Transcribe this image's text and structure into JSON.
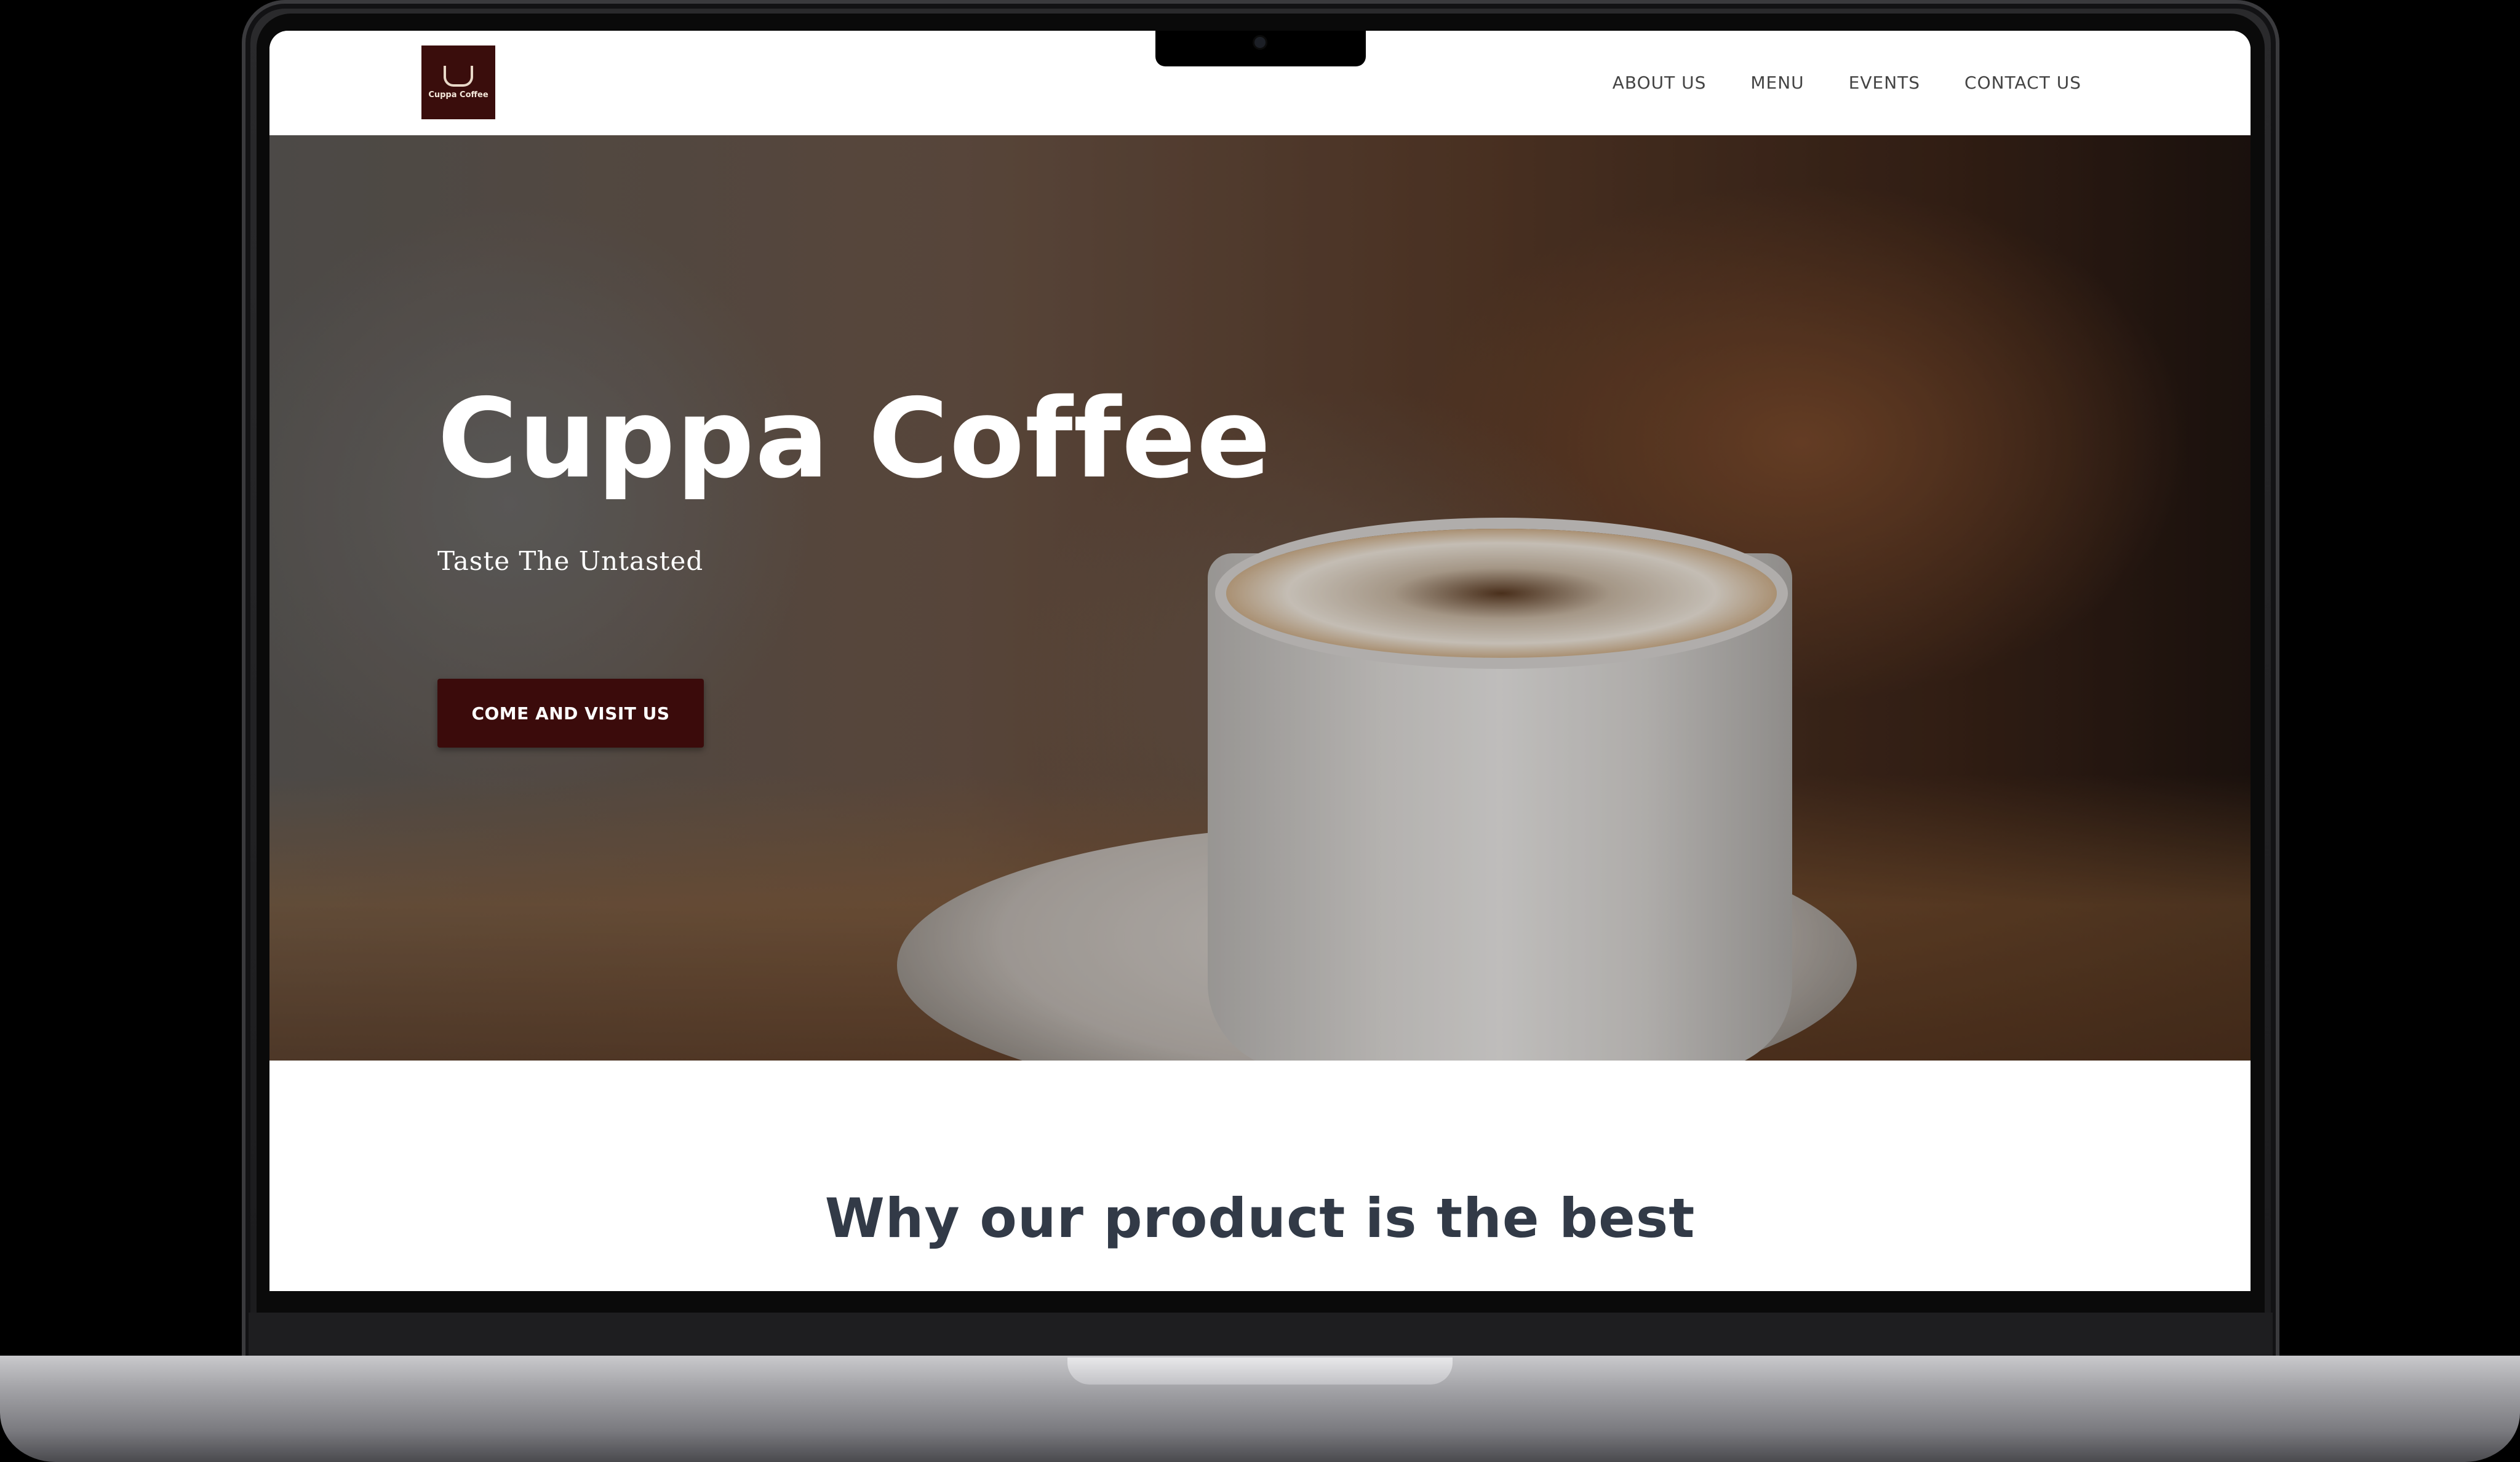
{
  "nav": {
    "logo_text": "Cuppa Coffee",
    "links": [
      {
        "label": "ABOUT US"
      },
      {
        "label": "MENU"
      },
      {
        "label": "EVENTS"
      },
      {
        "label": "CONTACT US"
      }
    ]
  },
  "hero": {
    "title": "Cuppa Coffee",
    "tagline": "Taste The Untasted",
    "cta_label": "COME AND VISIT US",
    "cta_color": "#3b0b0b"
  },
  "section": {
    "title": "Why our product is the best"
  }
}
